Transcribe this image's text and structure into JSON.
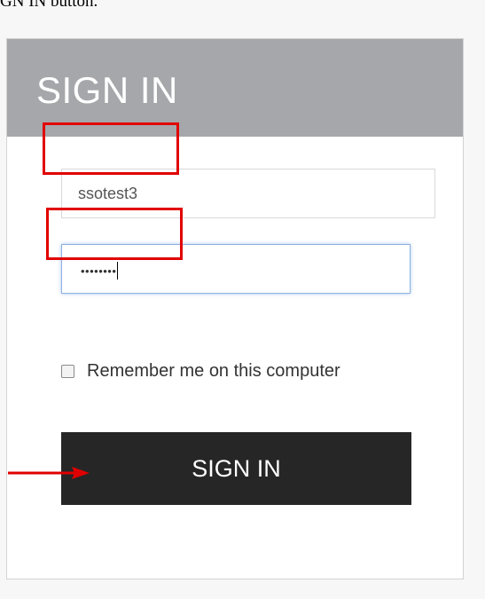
{
  "caption": {
    "fragment": "GN IN button."
  },
  "form": {
    "title": "SIGN IN",
    "username": {
      "value": "ssotest3"
    },
    "password": {
      "masked": "••••••••"
    },
    "remember": {
      "label": "Remember me on this computer",
      "checked": false
    },
    "submit_label": "SIGN IN"
  },
  "annotations": {
    "highlight_color": "#e10000",
    "arrow_color": "#e10000"
  },
  "colors": {
    "header_bg": "#a6a7aa",
    "button_bg": "#262626"
  }
}
